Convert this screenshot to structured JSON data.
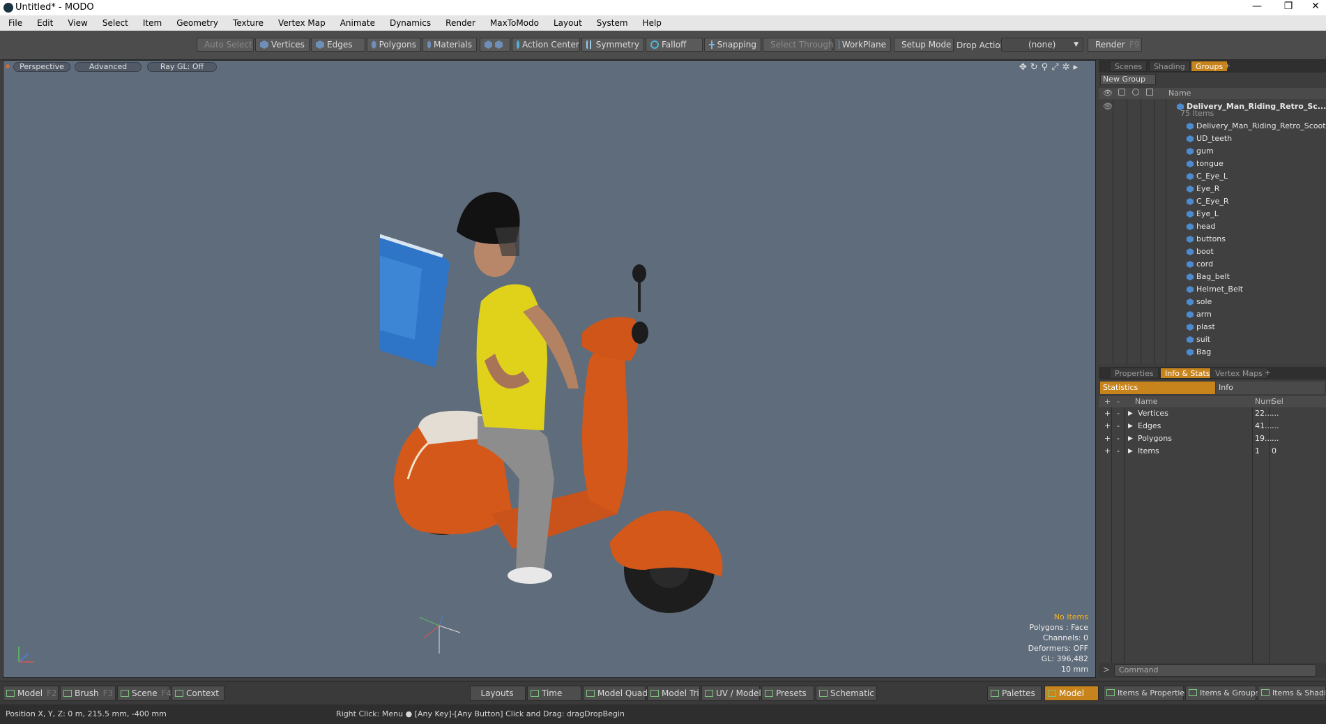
{
  "window": {
    "title": "Untitled* - MODO",
    "controls": [
      "—",
      "❐",
      "✕"
    ]
  },
  "menu": [
    "File",
    "Edit",
    "View",
    "Select",
    "Item",
    "Geometry",
    "Texture",
    "Vertex Map",
    "Animate",
    "Dynamics",
    "Render",
    "MaxToModo",
    "Layout",
    "System",
    "Help"
  ],
  "toolbar": {
    "auto_select": "Auto Select",
    "vertices": "Vertices",
    "edges": "Edges",
    "polygons": "Polygons",
    "materials": "Materials",
    "action_center": "Action Center",
    "symmetry": "Symmetry",
    "falloff": "Falloff",
    "snapping": "Snapping",
    "select_through": "Select Through",
    "workplane": "WorkPlane",
    "setup_mode": "Setup Mode",
    "drop_action_label": "Drop Action",
    "drop_action_value": "(none)",
    "render": "Render",
    "render_key": "F9"
  },
  "viewport": {
    "tabs": [
      "Perspective",
      "Advanced",
      "Ray GL: Off"
    ],
    "hud": {
      "selection": "No Items",
      "polygons": "Polygons : Face",
      "channels": "Channels: 0",
      "deformers": "Deformers: OFF",
      "gl": "GL: 396,482",
      "scale": "10 mm"
    }
  },
  "groups_panel": {
    "tabs": [
      "Scenes",
      "Shading",
      "Groups"
    ],
    "new_group": "New Group",
    "name_header": "Name",
    "root": {
      "name": "Delivery_Man_Riding_Retro_Sc...",
      "count": "75 Items"
    },
    "items": [
      "Delivery_Man_Riding_Retro_Scooter",
      "UD_teeth",
      "gum",
      "tongue",
      "C_Eye_L",
      "Eye_R",
      "C_Eye_R",
      "Eye_L",
      "head",
      "buttons",
      "boot",
      "cord",
      "Bag_belt",
      "Helmet_Belt",
      "sole",
      "arm",
      "plast",
      "suit",
      "Bag"
    ]
  },
  "stats_panel": {
    "tabs": [
      "Properties",
      "Info & Stats",
      "Vertex Maps"
    ],
    "statistics": "Statistics",
    "info": "Info",
    "headers": {
      "name": "Name",
      "num": "Num",
      "sel": "Sel"
    },
    "rows": [
      {
        "name": "Vertices",
        "num": "22...",
        "sel": "..."
      },
      {
        "name": "Edges",
        "num": "41...",
        "sel": "..."
      },
      {
        "name": "Polygons",
        "num": "19...",
        "sel": "..."
      },
      {
        "name": "Items",
        "num": "1",
        "sel": "0"
      }
    ],
    "command_placeholder": "Command"
  },
  "bottom": {
    "modes": [
      {
        "label": "Model",
        "key": "F2"
      },
      {
        "label": "Brush",
        "key": "F3"
      },
      {
        "label": "Scene",
        "key": "F4"
      },
      {
        "label": "Context",
        "key": ""
      }
    ],
    "layouts": "Layouts",
    "time": "Time",
    "views": [
      "Model Quad",
      "Model Tri",
      "UV / Model",
      "Presets",
      "Schematic"
    ],
    "palettes": "Palettes",
    "model": "Model",
    "right": [
      "Items & Properties",
      "Items & Groups",
      "Items & Shading"
    ]
  },
  "status": {
    "position": "Position X, Y, Z:   0 m, 215.5 mm, -400 mm",
    "hint": "Right Click: Menu ● [Any Key]-[Any Button] Click and Drag: dragDropBegin"
  }
}
